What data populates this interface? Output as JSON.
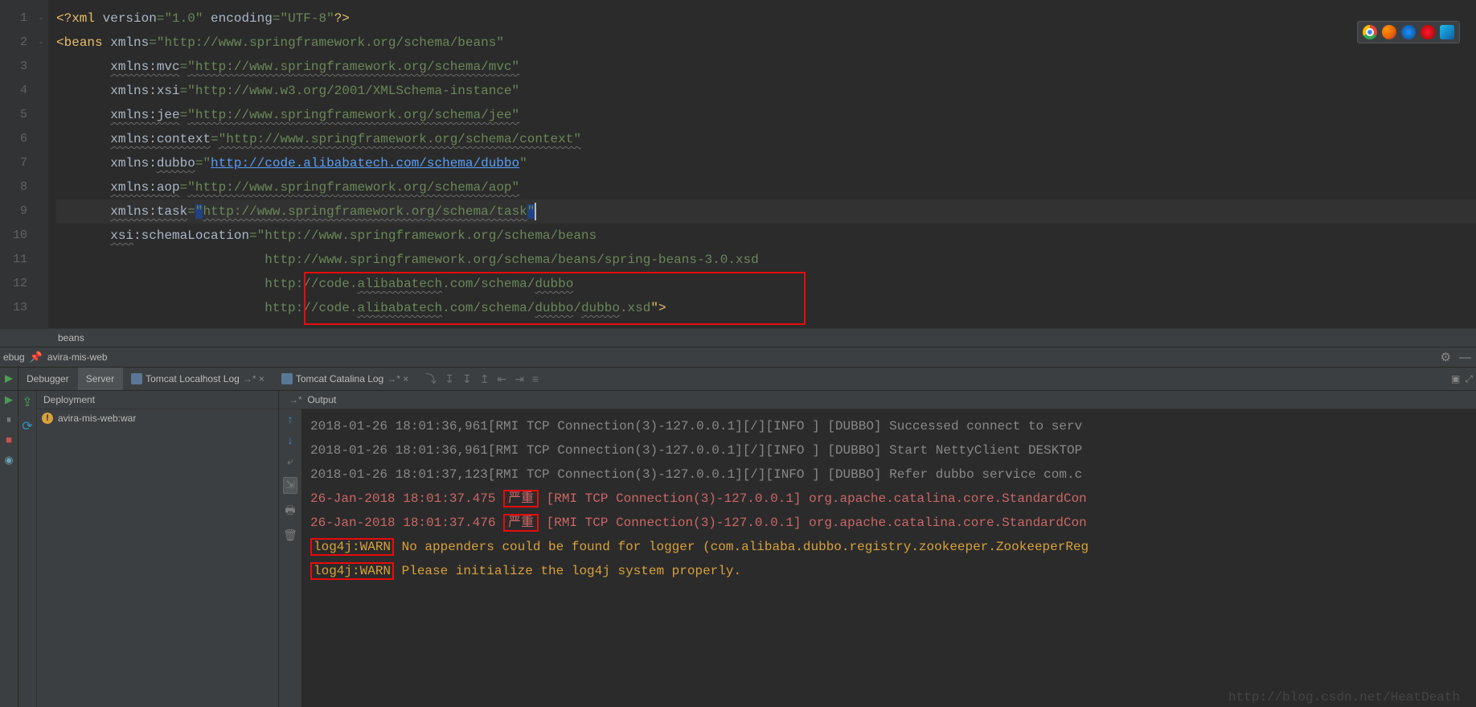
{
  "editor": {
    "line_numbers": [
      "1",
      "2",
      "3",
      "4",
      "5",
      "6",
      "7",
      "8",
      "9",
      "10",
      "11",
      "12",
      "13"
    ],
    "fold_marks": {
      "1": "-",
      "2": "-"
    },
    "xml_decl_open": "<?",
    "xml_decl_tag": "xml ",
    "xml_version_attr": "version",
    "xml_version_val": "\"1.0\"",
    "xml_encoding_attr": " encoding",
    "xml_encoding_val": "\"UTF-8\"",
    "xml_decl_close": "?>",
    "beans_open": "<",
    "beans_tag": "beans ",
    "beans_xmlns_attr": "xmlns",
    "beans_xmlns_val": "\"http://www.springframework.org/schema/beans\"",
    "mvc_attr": "xmlns:mvc",
    "mvc_val": "\"http://www.springframework.org/schema/mvc\"",
    "xsi_attr": "xmlns:xsi",
    "xsi_val": "\"http://www.w3.org/2001/XMLSchema-instance\"",
    "jee_attr": "xmlns:jee",
    "jee_val": "\"http://www.springframework.org/schema/jee\"",
    "context_attr": "xmlns:context",
    "context_val": "\"http://www.springframework.org/schema/context\"",
    "dubbo_attr": "xmlns:",
    "dubbo_attr2": "dubbo",
    "dubbo_q": "=\"",
    "dubbo_link": "http://code.alibabatech.com/schema/dubbo",
    "dubbo_end": "\"",
    "aop_attr": "xmlns:aop",
    "aop_val": "\"http://www.springframework.org/schema/aop\"",
    "task_attr": "xmlns:task",
    "task_q1": "=",
    "task_q2": "\"",
    "task_val": "http://www.springframework.org/schema/task",
    "task_q3": "\"",
    "loc_attr": "xsi",
    "loc_attr2": ":schemaLocation",
    "loc_q": "=\"",
    "loc_l1": "http://www.springframework.org/schema/beans",
    "loc_l2": "http://www.springframework.org/schema/beans/spring-beans-3.0.xsd",
    "loc_l3a": "http://code.",
    "loc_l3b": "alibabatech",
    "loc_l3c": ".com/schema/",
    "loc_l3d": "dubbo",
    "loc_l4a": "http://code.",
    "loc_l4b": "alibabatech",
    "loc_l4c": ".com/schema/",
    "loc_l4d": "dubbo",
    "loc_l4e": "/",
    "loc_l4f": "dubbo",
    "loc_l4g": ".xsd",
    "loc_end": "\">"
  },
  "breadcrumb": {
    "text": "beans"
  },
  "debug_bar": {
    "prefix": "ebug",
    "run_config": "avira-mis-web",
    "tab_debugger": "Debugger",
    "tab_server": "Server",
    "tab_localhost": "Tomcat Localhost Log",
    "tab_catalina": "Tomcat Catalina Log"
  },
  "deployment": {
    "header": "Deployment",
    "artifact": "avira-mis-web:war"
  },
  "output": {
    "header": "Output",
    "lines": [
      {
        "type": "info",
        "ts": "2018-01-26 18:01:36,961",
        "thread": "[RMI TCP Connection(3)-127.0.0.1][/][INFO ] [DUBBO] ",
        "msg": "Successed connect to serv"
      },
      {
        "type": "info",
        "ts": "2018-01-26 18:01:36,961",
        "thread": "[RMI TCP Connection(3)-127.0.0.1][/][INFO ] [DUBBO] ",
        "msg": "Start NettyClient DESKTOP"
      },
      {
        "type": "info",
        "ts": "2018-01-26 18:01:37,123",
        "thread": "[RMI TCP Connection(3)-127.0.0.1][/][INFO ] [DUBBO] ",
        "msg": "Refer dubbo service com.c"
      },
      {
        "type": "severe",
        "ts": "26-Jan-2018 18:01:37.475 ",
        "level": "严重",
        "rest": " [RMI TCP Connection(3)-127.0.0.1] org.apache.catalina.core.StandardCon"
      },
      {
        "type": "severe",
        "ts": "26-Jan-2018 18:01:37.476 ",
        "level": "严重",
        "rest": " [RMI TCP Connection(3)-127.0.0.1] org.apache.catalina.core.StandardCon"
      },
      {
        "type": "warn",
        "prefix": "log4j:WARN",
        "msg": " No appenders could be found for logger (com.alibaba.dubbo.registry.zookeeper.ZookeeperReg"
      },
      {
        "type": "warn",
        "prefix": "log4j:WARN",
        "msg": " Please initialize the log4j system properly."
      }
    ]
  },
  "watermark": "http://blog.csdn.net/HeatDeath"
}
